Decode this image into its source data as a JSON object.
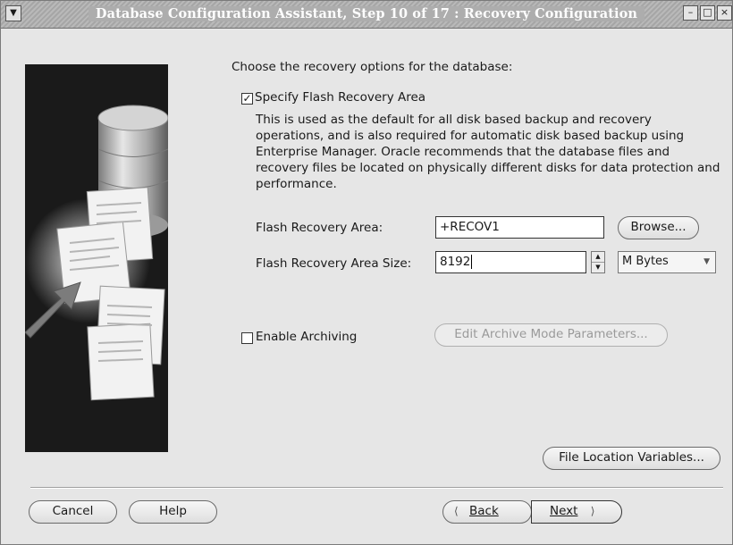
{
  "window": {
    "title": "Database Configuration Assistant, Step 10 of 17 : Recovery Configuration"
  },
  "main": {
    "heading": "Choose the recovery options for the database:",
    "flash_checkbox_label": "Specify Flash Recovery Area",
    "flash_checked": true,
    "description": "This is used as the default for all disk based backup and recovery operations, and is also required for automatic disk based backup using Enterprise Manager. Oracle recommends that the database files and recovery files be located on physically different disks for data protection and performance.",
    "flash_area_label": "Flash Recovery Area:",
    "flash_area_value": "+RECOV1",
    "browse_label": "Browse...",
    "flash_size_label": "Flash Recovery Area Size:",
    "flash_size_value": "8192",
    "size_unit": "M Bytes",
    "archiving_label": "Enable Archiving",
    "archiving_checked": false,
    "edit_archive_label": "Edit Archive Mode Parameters...",
    "file_location_label": "File Location Variables..."
  },
  "footer": {
    "cancel_label": "Cancel",
    "help_label": "Help",
    "back_label": "Back",
    "next_label": "Next"
  }
}
